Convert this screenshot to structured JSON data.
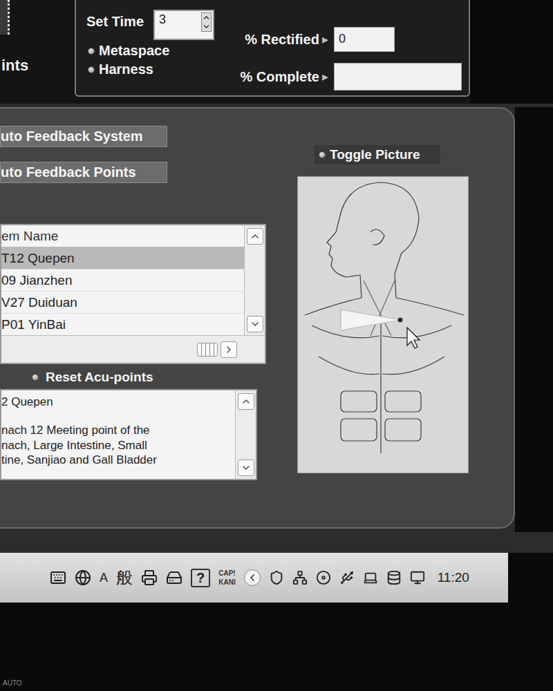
{
  "corner": {
    "label": "ints"
  },
  "header": {
    "set_time": {
      "label": "Set Time",
      "value": "3"
    },
    "modes": [
      {
        "label": "Metaspace",
        "selected": false
      },
      {
        "label": "Harness",
        "selected": false
      }
    ],
    "readouts": [
      {
        "label": "% Rectified",
        "arrow": "▸",
        "value": "0"
      },
      {
        "label": "% Complete",
        "arrow": "▸",
        "value": ""
      }
    ]
  },
  "buttons": [
    "uto Feedback System",
    "uto Feedback Points"
  ],
  "toggle_picture": {
    "label": "Toggle Picture",
    "selected": false
  },
  "points_list": {
    "column": "em Name",
    "rows": [
      {
        "label": "T12 Quepen",
        "selected": true
      },
      {
        "label": "09 Jianzhen",
        "selected": false
      },
      {
        "label": "V27 Duiduan",
        "selected": false
      },
      {
        "label": "P01 YinBai",
        "selected": false
      }
    ]
  },
  "reset": {
    "label": "Reset Acu-points",
    "selected": false
  },
  "description": {
    "title": "2 Quepen",
    "lines": [
      "nach 12 Meeting point of the",
      "nach, Large Intestine, Small",
      "tine, Sanjiao and Gall Bladder"
    ]
  },
  "taskbar": {
    "language": "A",
    "ime_mode": "般",
    "help": "?",
    "caps": "CAP!",
    "kana": "KANI",
    "clock": "11:20"
  },
  "monitor": {
    "brand": "AUTO"
  }
}
